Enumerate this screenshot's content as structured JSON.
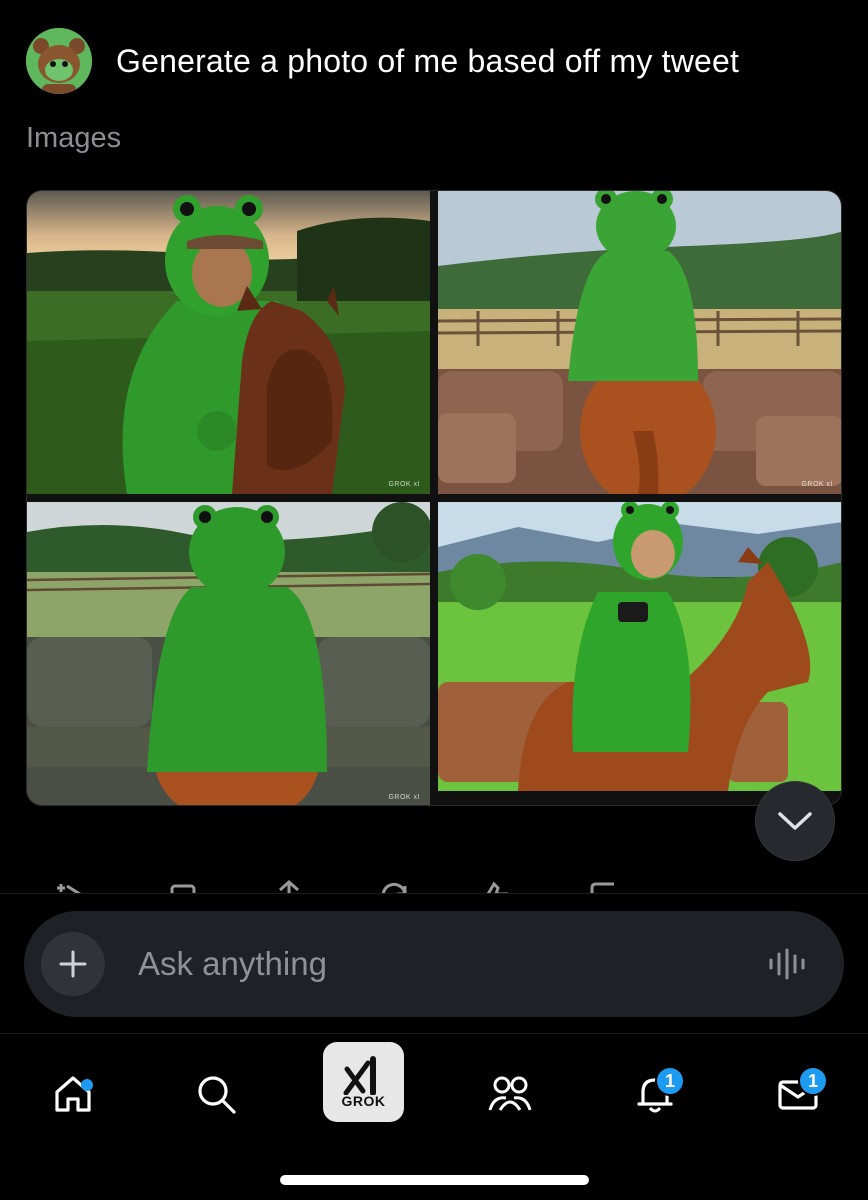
{
  "prompt": {
    "text": "Generate a photo of me based off my tweet"
  },
  "images_section": {
    "label": "Images",
    "watermark": "GROK xI"
  },
  "composer": {
    "placeholder": "Ask anything"
  },
  "tabbar": {
    "grok_label": "GROK",
    "notifications_badge": "1",
    "messages_badge": "1"
  },
  "colors": {
    "accent": "#1d9bf0",
    "background": "#000000",
    "composer_bg": "#1e2125",
    "muted_text": "#8b8f94"
  },
  "icons": {
    "scroll_down": "chevron-down-icon",
    "composer_plus": "plus-icon",
    "composer_voice": "voice-waveform-icon",
    "home": "home-icon",
    "search": "search-icon",
    "grok": "grok-logo-icon",
    "communities": "people-icon",
    "notifications": "bell-icon",
    "messages": "envelope-icon"
  }
}
